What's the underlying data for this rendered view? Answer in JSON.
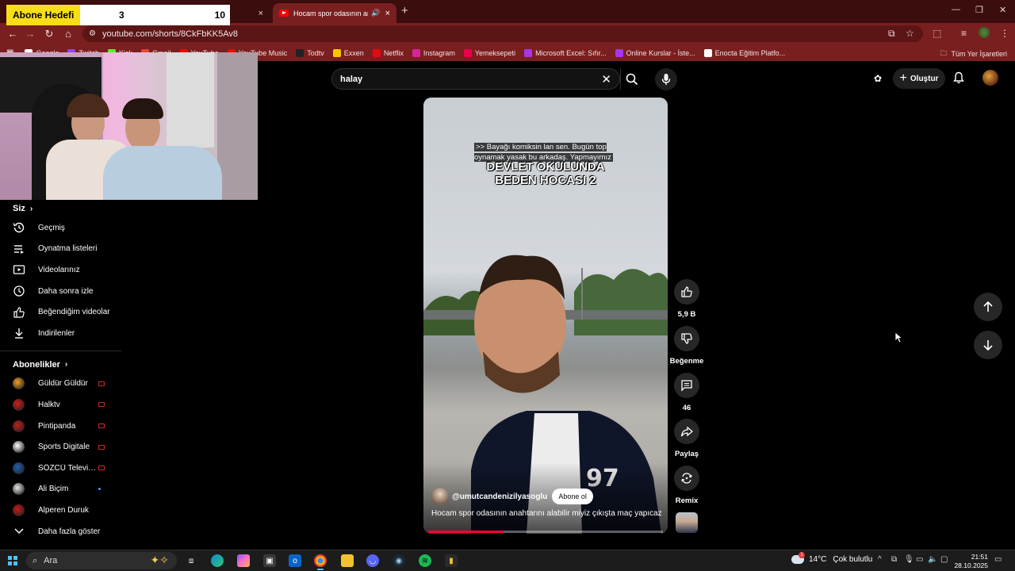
{
  "browser": {
    "tab_inactive_close": "×",
    "active_tab_title": "Hocam spor odasının anahta",
    "new_tab": "+",
    "url": "youtube.com/shorts/8CkFbKK5Av8",
    "bookmarks": [
      {
        "label": "Google",
        "color": "#ffffff"
      },
      {
        "label": "Twitch",
        "color": "#9146ff"
      },
      {
        "label": "Kick",
        "color": "#53fc18"
      },
      {
        "label": "Gmail",
        "color": "#ea4335"
      },
      {
        "label": "YouTube",
        "color": "#ff0000"
      },
      {
        "label": "YouTube Music",
        "color": "#ff0000"
      },
      {
        "label": "Todtv",
        "color": "#222222"
      },
      {
        "label": "Exxen",
        "color": "#f7c600"
      },
      {
        "label": "Netflix",
        "color": "#e50914"
      },
      {
        "label": "Instagram",
        "color": "#d6249f"
      },
      {
        "label": "Yemeksepeti",
        "color": "#ea004b"
      },
      {
        "label": "Microsoft Excel: Sıfır...",
        "color": "#a435f0"
      },
      {
        "label": "Online Kurslar - İste...",
        "color": "#a435f0"
      },
      {
        "label": "Enocta Eğitim Platfo...",
        "color": "#ffffff"
      }
    ],
    "all_bookmarks": "Tüm Yer İşaretleri"
  },
  "overlay": {
    "goal_label": "Abone Hedefi",
    "goal_current": "3",
    "goal_target": "10"
  },
  "youtube": {
    "search_query": "halay",
    "create_label": "Oluştur"
  },
  "sidebar": {
    "you_header": "Siz",
    "you_items": [
      {
        "label": "Geçmiş",
        "icon": "history-icon"
      },
      {
        "label": "Oynatma listeleri",
        "icon": "playlist-icon"
      },
      {
        "label": "Videolarınız",
        "icon": "your-videos-icon"
      },
      {
        "label": "Daha sonra izle",
        "icon": "watch-later-icon"
      },
      {
        "label": "Beğendiğim videolar",
        "icon": "like-icon"
      },
      {
        "label": "İndirilenler",
        "icon": "download-icon"
      }
    ],
    "subs_header": "Abonelikler",
    "subscriptions": [
      {
        "label": "Güldür Güldür",
        "status": "live",
        "color": "#f0a020"
      },
      {
        "label": "Halktv",
        "status": "live",
        "color": "#d01c1c"
      },
      {
        "label": "Pintipanda",
        "status": "live",
        "color": "#c0201a"
      },
      {
        "label": "Sports Digitale",
        "status": "live",
        "color": "#ffffff"
      },
      {
        "label": "SÖZCÜ Televizyonu",
        "status": "live",
        "color": "#1f5fb0"
      },
      {
        "label": "Ali Biçim",
        "status": "new",
        "color": "#e8e8e8"
      },
      {
        "label": "Alperen Duruk",
        "status": "none",
        "color": "#c81818"
      }
    ],
    "show_more": "Daha fazla göster"
  },
  "short": {
    "caption": ">> Bayağı komiksin lan sen. Bugün top oynamak yasak bu arkadaş. Yapmayımız",
    "burned_text_1": "DEVLET OKULUNDA",
    "burned_text_2": "BEDEN HOCASI 2",
    "channel": "@umutcandenizilyasoglu",
    "subscribe": "Abone ol",
    "title": "Hocam spor odasının anahtarını alabilir miyiz çıkışta maç yapıcaz",
    "progress": 0.32
  },
  "actions": {
    "likes": "5,9 B",
    "dislike": "Beğenme",
    "comments": "46",
    "share": "Paylaş",
    "remix": "Remix"
  },
  "taskbar": {
    "search_placeholder": "Ara",
    "weather_temp": "14°C",
    "weather_text": "Çok bulutlu",
    "weather_badge": "1",
    "time": "21:51",
    "date": "28.10.2025"
  }
}
